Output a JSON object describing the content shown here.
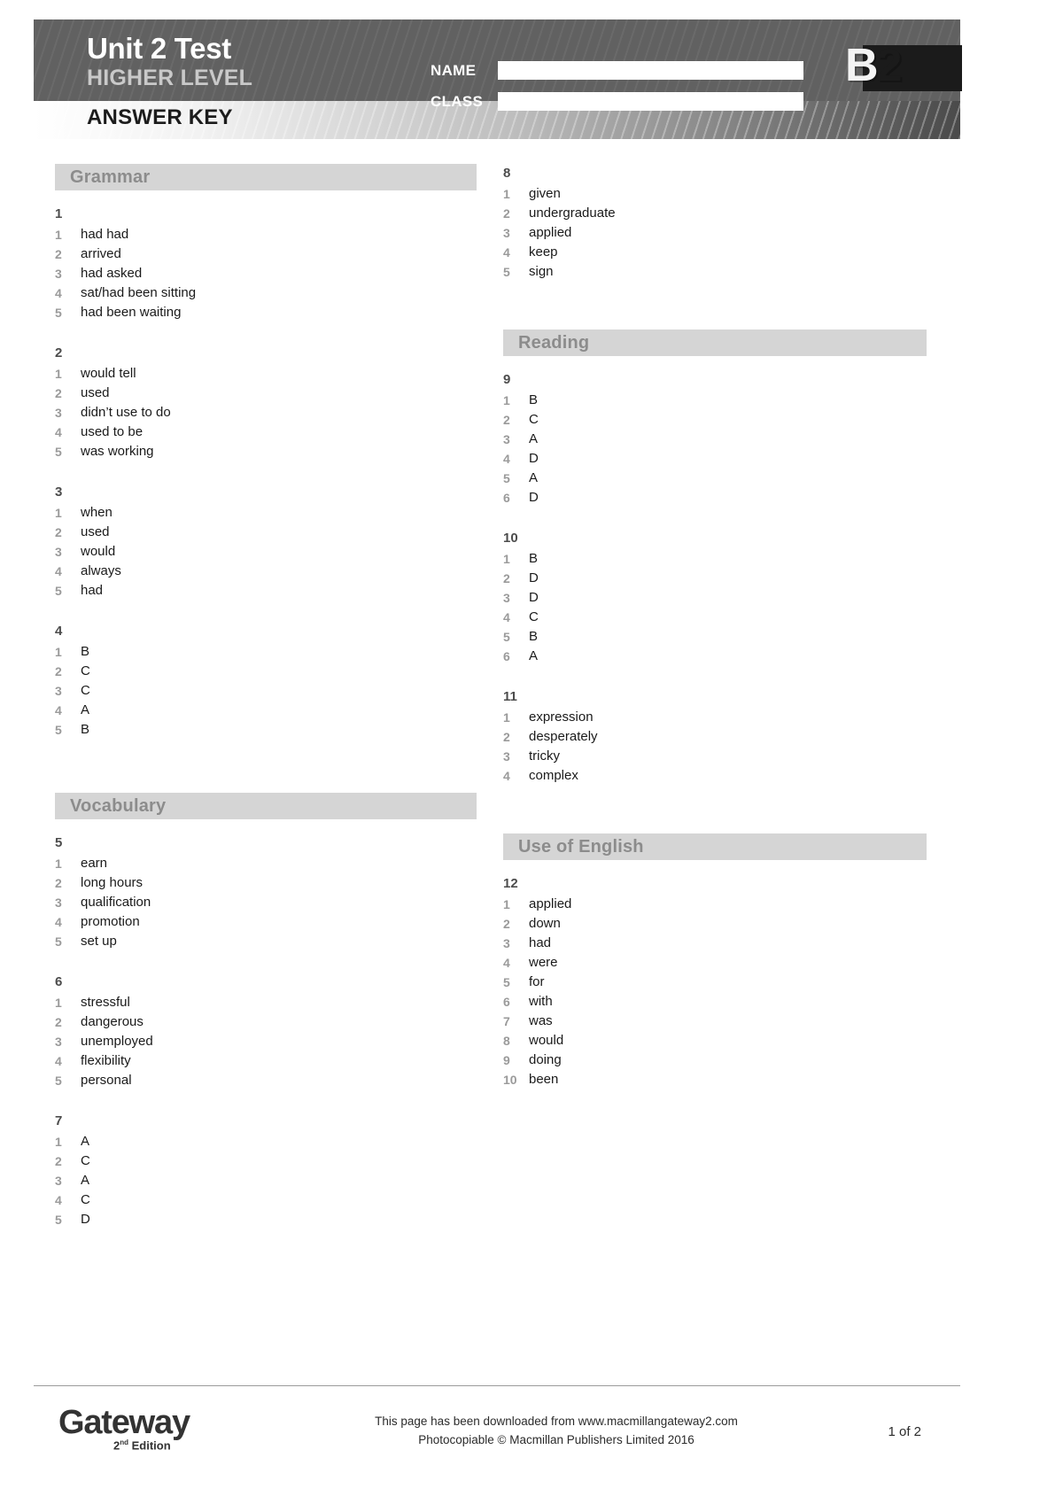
{
  "header": {
    "title": "Unit 2 Test",
    "subtitle": "HIGHER LEVEL",
    "answer_key": "ANSWER KEY",
    "name_label": "NAME",
    "class_label": "CLASS",
    "name_value": "",
    "class_value": "",
    "name_placeholder": "",
    "class_placeholder": "",
    "level_badge_b": "B",
    "level_badge_2": "2"
  },
  "sections": {
    "grammar": "Grammar",
    "vocabulary": "Vocabulary",
    "reading": "Reading",
    "use_of_english": "Use of English"
  },
  "exercises": {
    "ex1": {
      "number": "1",
      "items": [
        {
          "n": "1",
          "answer": "had had"
        },
        {
          "n": "2",
          "answer": "arrived"
        },
        {
          "n": "3",
          "answer": "had asked"
        },
        {
          "n": "4",
          "answer": "sat/had been sitting"
        },
        {
          "n": "5",
          "answer": "had been waiting"
        }
      ]
    },
    "ex2": {
      "number": "2",
      "items": [
        {
          "n": "1",
          "answer": "would tell"
        },
        {
          "n": "2",
          "answer": "used"
        },
        {
          "n": "3",
          "answer": "didn’t use to do"
        },
        {
          "n": "4",
          "answer": "used to be"
        },
        {
          "n": "5",
          "answer": "was working"
        }
      ]
    },
    "ex3": {
      "number": "3",
      "items": [
        {
          "n": "1",
          "answer": "when"
        },
        {
          "n": "2",
          "answer": "used"
        },
        {
          "n": "3",
          "answer": "would"
        },
        {
          "n": "4",
          "answer": "always"
        },
        {
          "n": "5",
          "answer": "had"
        }
      ]
    },
    "ex4": {
      "number": "4",
      "items": [
        {
          "n": "1",
          "answer": "B"
        },
        {
          "n": "2",
          "answer": "C"
        },
        {
          "n": "3",
          "answer": "C"
        },
        {
          "n": "4",
          "answer": "A"
        },
        {
          "n": "5",
          "answer": "B"
        }
      ]
    },
    "ex5": {
      "number": "5",
      "items": [
        {
          "n": "1",
          "answer": "earn"
        },
        {
          "n": "2",
          "answer": "long hours"
        },
        {
          "n": "3",
          "answer": "qualification"
        },
        {
          "n": "4",
          "answer": "promotion"
        },
        {
          "n": "5",
          "answer": "set up"
        }
      ]
    },
    "ex6": {
      "number": "6",
      "items": [
        {
          "n": "1",
          "answer": "stressful"
        },
        {
          "n": "2",
          "answer": "dangerous"
        },
        {
          "n": "3",
          "answer": "unemployed"
        },
        {
          "n": "4",
          "answer": "flexibility"
        },
        {
          "n": "5",
          "answer": "personal"
        }
      ]
    },
    "ex7": {
      "number": "7",
      "items": [
        {
          "n": "1",
          "answer": "A"
        },
        {
          "n": "2",
          "answer": "C"
        },
        {
          "n": "3",
          "answer": "A"
        },
        {
          "n": "4",
          "answer": "C"
        },
        {
          "n": "5",
          "answer": "D"
        }
      ]
    },
    "ex8": {
      "number": "8",
      "items": [
        {
          "n": "1",
          "answer": "given"
        },
        {
          "n": "2",
          "answer": "undergraduate"
        },
        {
          "n": "3",
          "answer": "applied"
        },
        {
          "n": "4",
          "answer": "keep"
        },
        {
          "n": "5",
          "answer": "sign"
        }
      ]
    },
    "ex9": {
      "number": "9",
      "items": [
        {
          "n": "1",
          "answer": "B"
        },
        {
          "n": "2",
          "answer": "C"
        },
        {
          "n": "3",
          "answer": "A"
        },
        {
          "n": "4",
          "answer": "D"
        },
        {
          "n": "5",
          "answer": "A"
        },
        {
          "n": "6",
          "answer": "D"
        }
      ]
    },
    "ex10": {
      "number": "10",
      "items": [
        {
          "n": "1",
          "answer": "B"
        },
        {
          "n": "2",
          "answer": "D"
        },
        {
          "n": "3",
          "answer": "D"
        },
        {
          "n": "4",
          "answer": "C"
        },
        {
          "n": "5",
          "answer": "B"
        },
        {
          "n": "6",
          "answer": "A"
        }
      ]
    },
    "ex11": {
      "number": "11",
      "items": [
        {
          "n": "1",
          "answer": "expression"
        },
        {
          "n": "2",
          "answer": "desperately"
        },
        {
          "n": "3",
          "answer": "tricky"
        },
        {
          "n": "4",
          "answer": "complex"
        }
      ]
    },
    "ex12": {
      "number": "12",
      "items": [
        {
          "n": "1",
          "answer": "applied"
        },
        {
          "n": "2",
          "answer": "down"
        },
        {
          "n": "3",
          "answer": "had"
        },
        {
          "n": "4",
          "answer": "were"
        },
        {
          "n": "5",
          "answer": "for"
        },
        {
          "n": "6",
          "answer": "with"
        },
        {
          "n": "7",
          "answer": "was"
        },
        {
          "n": "8",
          "answer": "would"
        },
        {
          "n": "9",
          "answer": "doing"
        },
        {
          "n": "10",
          "answer": "been"
        }
      ]
    }
  },
  "footer": {
    "logo_word": "Gateway",
    "logo_edition_num": "2",
    "logo_edition_sup": "nd",
    "logo_edition_rest": " Edition",
    "line1": "This page has been downloaded from www.macmillangateway2.com",
    "line2": "Photocopiable © Macmillan Publishers Limited 2016",
    "page_number": "1 of 2"
  },
  "colors": {
    "header_dark": "#616161",
    "section_bar": "#d5d5d5",
    "section_title": "#8c8c8c",
    "answer_num": "#9a9a9a",
    "text": "#1a1a1a"
  }
}
